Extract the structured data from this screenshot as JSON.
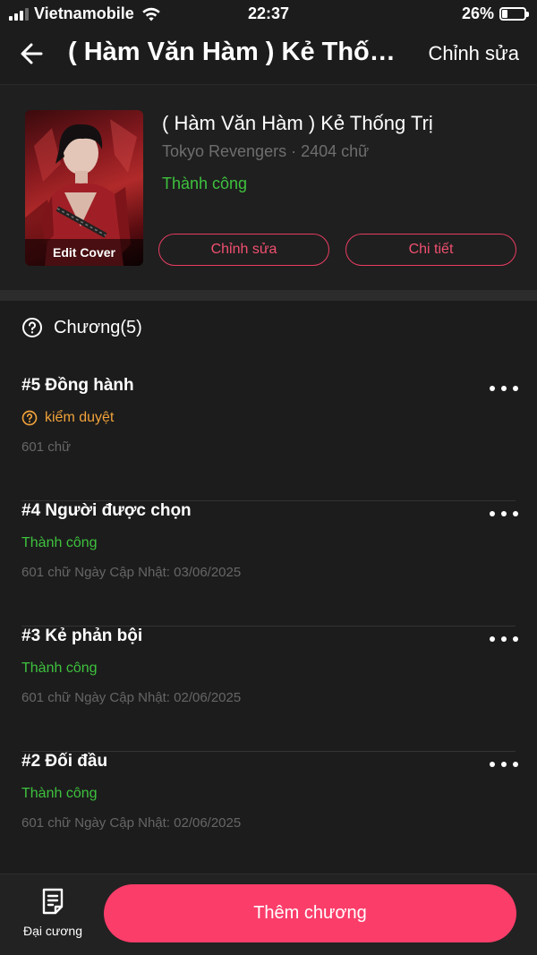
{
  "status_bar": {
    "carrier": "Vietnamobile",
    "time": "22:37",
    "battery": "26%",
    "battery_level": 0.26
  },
  "nav": {
    "title": "( Hàm Văn Hàm ) Kẻ Thống Trị",
    "edit_label": "Chỉnh sửa",
    "back_icon": "arrow-left-icon"
  },
  "story": {
    "cover_label": "Edit Cover",
    "title": "( Hàm Văn Hàm ) Kẻ Thống Trị",
    "meta": "Tokyo Revengers · 2404 chữ",
    "status": "Thành công",
    "edit_button": "Chỉnh sửa",
    "detail_button": "Chi tiết"
  },
  "chapters": {
    "header": "Chương(5)",
    "header_icon": "question-circle-icon",
    "items": [
      {
        "title": "#5 Đồng hành",
        "status": "kiểm duyệt",
        "status_type": "pending",
        "meta": "601 chữ"
      },
      {
        "title": "#4 Người được chọn",
        "status": "Thành công",
        "status_type": "success",
        "meta": "601 chữ Ngày Cập Nhật: 03/06/2025"
      },
      {
        "title": "#3 Kẻ phản bội",
        "status": "Thành công",
        "status_type": "success",
        "meta": "601 chữ Ngày Cập Nhật: 02/06/2025"
      },
      {
        "title": "#2 Đối đầu",
        "status": "Thành công",
        "status_type": "success",
        "meta": "601 chữ Ngày Cập Nhật: 02/06/2025"
      }
    ]
  },
  "bottom": {
    "outline_label": "Đại cương",
    "outline_icon": "document-icon",
    "add_chapter": "Thêm chương"
  },
  "colors": {
    "accent": "#fb3d6a",
    "success": "#3ec23e",
    "pending": "#f0a23a",
    "background": "#1c1c1c"
  }
}
